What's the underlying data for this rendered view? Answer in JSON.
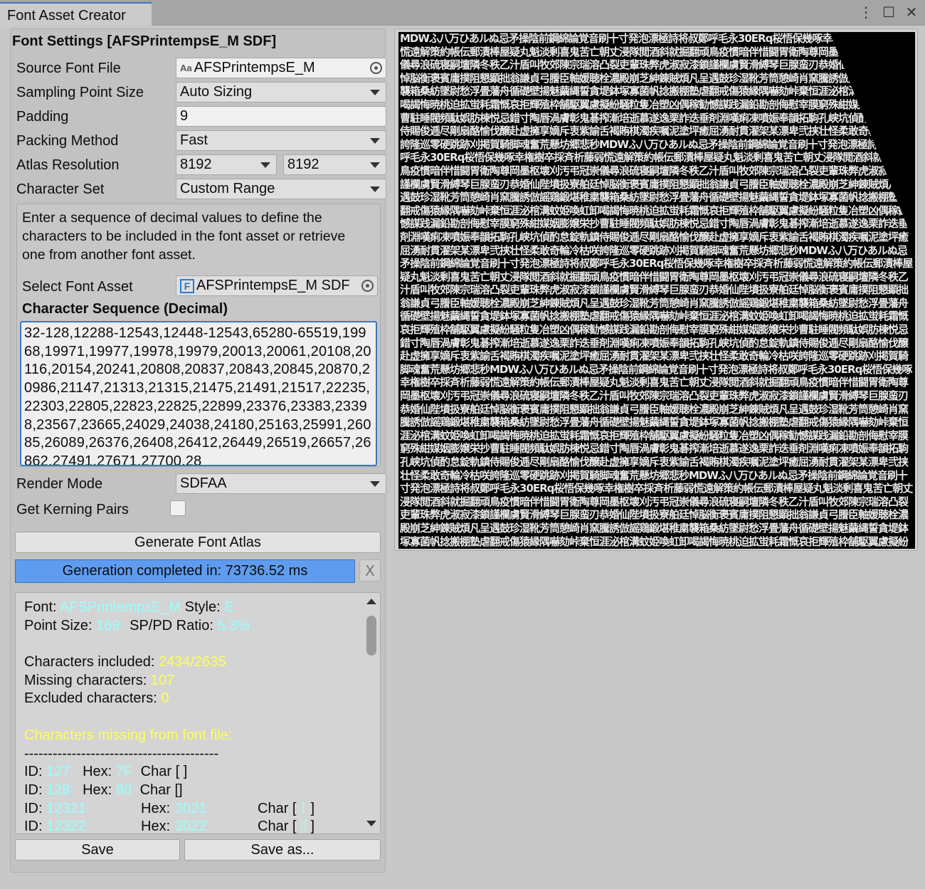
{
  "window": {
    "tab_title": "Font Asset Creator",
    "controls": [
      "⋮",
      "☐",
      "✕"
    ]
  },
  "settings": {
    "heading": "Font Settings [AFSPrintempsE_M SDF]",
    "source_font_file": {
      "label": "Source Font File",
      "value": "AFSPrintempsE_M",
      "icon_text": "Aa"
    },
    "sampling_point_size": {
      "label": "Sampling Point Size",
      "value": "Auto Sizing"
    },
    "padding": {
      "label": "Padding",
      "value": "9"
    },
    "packing_method": {
      "label": "Packing Method",
      "value": "Fast"
    },
    "atlas_resolution": {
      "label": "Atlas Resolution",
      "width": "8192",
      "height": "8192"
    },
    "character_set": {
      "label": "Character Set",
      "value": "Custom Range"
    },
    "help_text": "Enter a sequence of decimal values to define the characters to be included in the font asset or retrieve one from another font asset.",
    "select_font_asset": {
      "label": "Select Font Asset",
      "value": "AFSPrintempsE_M SDF",
      "icon_text": "F"
    },
    "character_sequence_title": "Character Sequence (Decimal)",
    "character_sequence": "32-128,12288-12543,12448-12543,65280-65519,19968,19971,19977,19978,19979,20013,20061,20108,20116,20154,20241,20808,20837,20843,20845,20870,20986,21147,21313,21315,21475,21491,21517,22235,22303,22805,22823,22825,22899,23376,23383,23398,23567,23665,24029,24038,24180,25163,25991,26085,26089,26376,26408,26412,26449,26519,26657,26862,27491,27671,27700,28",
    "render_mode": {
      "label": "Render Mode",
      "value": "SDFAA"
    },
    "kerning": {
      "label": "Get Kerning Pairs",
      "checked": false
    }
  },
  "actions": {
    "generate_label": "Generate Font Atlas",
    "progress_text": "Generation completed in: 73736.52 ms",
    "progress_value": 1.0,
    "close_label": "X",
    "save_label": "Save",
    "save_as_label": "Save as..."
  },
  "report": {
    "font_label": "Font:",
    "font_value": "AFSPrintempsE_M",
    "style_label": "Style:",
    "style_value": "E",
    "point_size_label": "Point Size:",
    "point_size_value": "169",
    "ratio_label": "SP/PD Ratio:",
    "ratio_value": "5.3%",
    "included_label": "Characters included:",
    "included_value": "2434/2635",
    "missing_label": "Missing characters:",
    "missing_value": "107",
    "excluded_label": "Excluded characters:",
    "excluded_value": "0",
    "missing_title": "Characters missing from font file:",
    "separator": "-----------------------------------------",
    "entries": [
      {
        "id_label": "ID:",
        "id": "127",
        "hex_label": "Hex:",
        "hex": "7F",
        "char_label": "Char [",
        "char": " ",
        "char_end": "]"
      },
      {
        "id_label": "ID:",
        "id": "128",
        "hex_label": "Hex:",
        "hex": "80",
        "char_label": "Char [",
        "char": "",
        "char_end": "]"
      },
      {
        "id_label": "ID:",
        "id": "12321",
        "hex_label": "Hex:",
        "hex": "3021",
        "char_label": "Char [",
        "char": "〡",
        "char_end": "]"
      },
      {
        "id_label": "ID:",
        "id": "12322",
        "hex_label": "Hex:",
        "hex": "3022",
        "char_label": "Char [",
        "char": "〢",
        "char_end": "]"
      }
    ]
  },
  "atlas": {
    "glyphs": "MDWふ八万ひあルぬ忌矛操陰前鋼綿論覚音刷十寸発泡漂極詩将叔鄭呼毛永30ERq桜悟保幾啄幸権樹卒採斉析藤弱慌遠解策約帳伝郵漬棒屋疑丸魁淡剰喜鬼苦亡朝丈浸隊閲酒斜就掘翻頑鳥疫慣暗伴惜闘胃衛陶尊岡墨枢壊刈汚弔冠崇儀尋浪硫寝嗣壇隣冬秩乙汁盾叫牧郊陳宗瑞溶凸裂吏輩珠弊虎淑寂漆鎖謹欄虜賢滑縛琴巨腺蛮刃恭婚仙陛墳扱寮舶廷悼脳衡褒賓庸撲阻懇顕拙翁謙貞弓謄臣軸媛聴栓濃殿崩芝紳錬賊煩凡呈遇鼓珍湿靴芳筒憩崎肖窯騰誘倣謡鶏鍛堪稚粛襲箱桑紡墜尉愁浮畳藩舟循礎壁揚魅繭縄誓貪堤鉢塚寡菌帆捻搬棚塾虐翻戒傷猿縁隅嚇劾峠棄恒涯泌棺溝蚊姫喚虹卸喝謁悔暁桃迫拡蛍耗霜慨哀拒輝殖枠舗駆翼慮擬紛騒粒隻冶塑凶偶稼勧憾謀践漏鉛勘剖侮慰宰膜窮殊紺媒姻膨嬢栄抄曹駐睡閥頻駄娯肪棟悦忌錯寸陶唇渦膚彰鬼碁搾漸培逝慕遂逸栗詐迭垂剤淵嘆痢凍噴娠奉韻拓駒孔峡坑偵酌怠錠軌鎮侍賜俊逓尽剛扇酪愉伐醸赴虚擁享嫡斥衷紫諭舌褐賄棋濁疾嘱泥塗坪癒屈湧耐貫濯架某漂卑弐挟壮怪柔敢奇輪冷枯咲誇隆巡零硬跳跡刈掲賀騎脚魂奮荒懸坊郷悲秒",
    "bg_color": "#000000",
    "glyph_color": "#e8e8e8"
  }
}
